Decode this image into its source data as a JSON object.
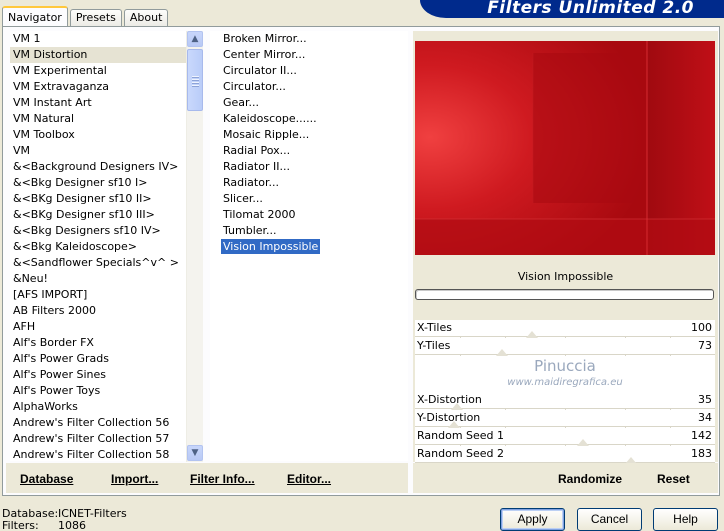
{
  "tabs": [
    "Navigator",
    "Presets",
    "About"
  ],
  "app_title": "Filters Unlimited 2.0",
  "categories": [
    "VM 1",
    "VM Distortion",
    "VM Experimental",
    "VM Extravaganza",
    "VM Instant Art",
    "VM Natural",
    "VM Toolbox",
    "VM",
    "&<Background Designers IV>",
    "&<Bkg Designer sf10 I>",
    "&<BKg Designer sf10 II>",
    "&<BKg Designer sf10 III>",
    "&<Bkg Designers sf10 IV>",
    "&<Bkg Kaleidoscope>",
    "&<Sandflower Specials^v^ >",
    "&Neu!",
    "[AFS IMPORT]",
    "AB Filters 2000",
    "AFH",
    "Alf's Border FX",
    "Alf's Power Grads",
    "Alf's Power Sines",
    "Alf's Power Toys",
    "AlphaWorks",
    "Andrew's Filter Collection 56",
    "Andrew's Filter Collection 57",
    "Andrew's Filter Collection 58"
  ],
  "selected_category": "VM Distortion",
  "filters": [
    "Broken Mirror...",
    "Center Mirror...",
    "Circulator II...",
    "Circulator...",
    "Gear...",
    "Kaleidoscope......",
    "Mosaic Ripple...",
    "Radial Pox...",
    "Radiator II...",
    "Radiator...",
    "Slicer...",
    "Tilomat 2000",
    "Tumbler...",
    "Vision Impossible"
  ],
  "selected_filter": "Vision Impossible",
  "filter_name": "Vision Impossible",
  "params": [
    {
      "label": "X-Tiles",
      "value": "100",
      "level": 0.39
    },
    {
      "label": "Y-Tiles",
      "value": "73",
      "level": 0.29
    },
    {
      "label": "X-Distortion",
      "value": "35",
      "level": 0.14
    },
    {
      "label": "Y-Distortion",
      "value": "34",
      "level": 0.13
    },
    {
      "label": "Random Seed 1",
      "value": "142",
      "level": 0.56
    },
    {
      "label": "Random Seed 2",
      "value": "183",
      "level": 0.72
    }
  ],
  "watermark": {
    "name": "Pinuccia",
    "url": "www.maidiregrafica.eu"
  },
  "bottom_links": {
    "database": "Database",
    "import": "Import...",
    "filter_info": "Filter Info...",
    "editor": "Editor...",
    "randomize": "Randomize",
    "reset": "Reset"
  },
  "status": {
    "database_label": "Database:",
    "database_value": "ICNET-Filters",
    "filters_label": "Filters:",
    "filters_value": "1086"
  },
  "buttons": {
    "apply": "Apply",
    "cancel": "Cancel",
    "help": "Help"
  },
  "colors": {
    "preview_red": "#c8111b",
    "selection_blue": "#316ac5",
    "banner_blue": "#002a8c"
  }
}
